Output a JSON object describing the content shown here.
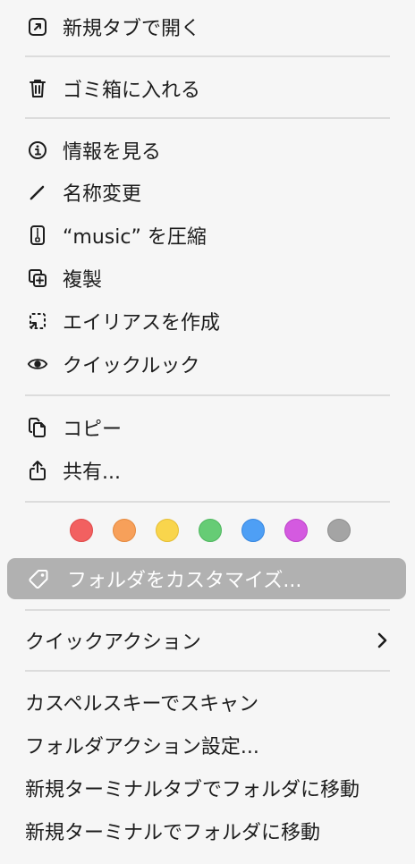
{
  "menu": {
    "open_new_tab": "新規タブで開く",
    "move_to_trash": "ゴミ箱に入れる",
    "get_info": "情報を見る",
    "rename": "名称変更",
    "compress": "“music” を圧縮",
    "duplicate": "複製",
    "make_alias": "エイリアスを作成",
    "quick_look": "クイックルック",
    "copy": "コピー",
    "share": "共有...",
    "customize_folder": "フォルダをカスタマイズ...",
    "quick_actions": "クイックアクション",
    "scan_kaspersky": "カスペルスキーでスキャン",
    "folder_action_setup": "フォルダアクション設定...",
    "new_terminal_tab_at_folder": "新規ターミナルタブでフォルダに移動",
    "new_terminal_at_folder": "新規ターミナルでフォルダに移動"
  },
  "tags": [
    {
      "color": "#f26060",
      "border": "#e04a4a"
    },
    {
      "color": "#f7a05a",
      "border": "#e58a3f"
    },
    {
      "color": "#f9d54c",
      "border": "#e5be35"
    },
    {
      "color": "#66cc75",
      "border": "#4fb75f"
    },
    {
      "color": "#4e9ff5",
      "border": "#3787e0"
    },
    {
      "color": "#d45ae0",
      "border": "#bd42c9"
    },
    {
      "color": "#a4a4a4",
      "border": "#8e8e8e"
    }
  ],
  "icons": {
    "open_new_tab": "open-in-new-tab-icon",
    "move_to_trash": "trash-icon",
    "get_info": "info-icon",
    "rename": "pencil-icon",
    "compress": "zip-archive-icon",
    "duplicate": "duplicate-icon",
    "make_alias": "alias-icon",
    "quick_look": "eye-icon",
    "copy": "copy-icon",
    "share": "share-icon",
    "customize_folder": "tag-icon",
    "quick_actions_submenu": "chevron-right-icon"
  },
  "colors": {
    "menu_background": "#f6f6f6",
    "highlight": "#b1b1b1",
    "text": "#1d1d1d",
    "separator": "#dcdcdc"
  }
}
